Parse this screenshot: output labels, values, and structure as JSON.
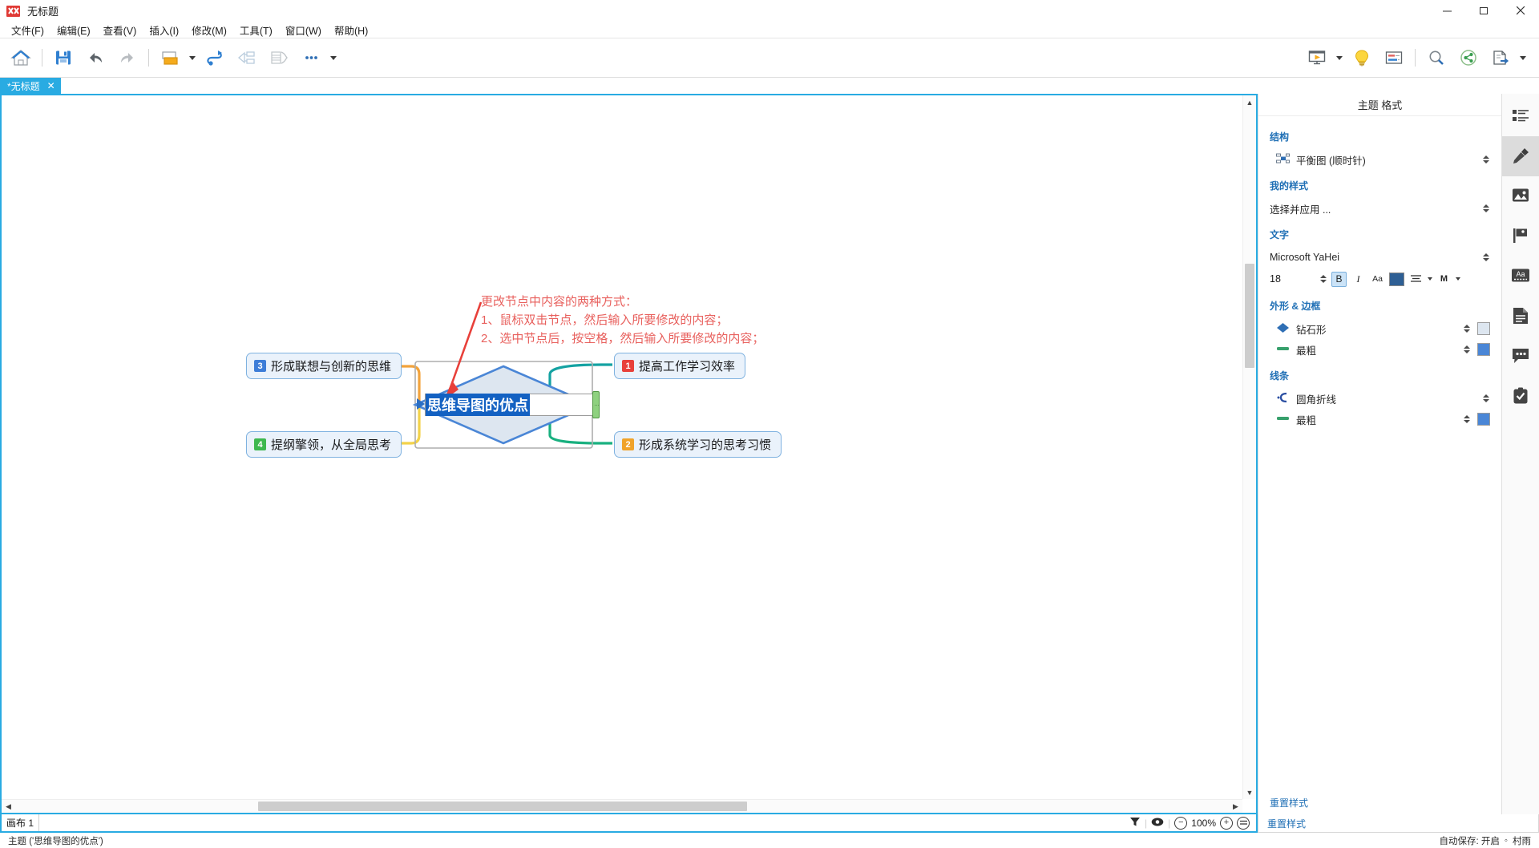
{
  "window": {
    "title": "无标题",
    "logo_icon": "xmind-logo-icon",
    "minimize": "–",
    "maximize": "❐",
    "close": "✕"
  },
  "menubar": {
    "items": [
      {
        "label": "文件(F)",
        "name": "menu-file"
      },
      {
        "label": "编辑(E)",
        "name": "menu-edit"
      },
      {
        "label": "查看(V)",
        "name": "menu-view"
      },
      {
        "label": "插入(I)",
        "name": "menu-insert"
      },
      {
        "label": "修改(M)",
        "name": "menu-modify"
      },
      {
        "label": "工具(T)",
        "name": "menu-tools"
      },
      {
        "label": "窗口(W)",
        "name": "menu-window"
      },
      {
        "label": "帮助(H)",
        "name": "menu-help"
      }
    ]
  },
  "toolbar": {
    "left": [
      {
        "icon": "home-icon",
        "name": "home-button"
      },
      {
        "icon": "save-icon",
        "name": "save-button"
      },
      {
        "icon": "undo-icon",
        "name": "undo-button"
      },
      {
        "icon": "redo-icon",
        "name": "redo-button"
      },
      {
        "icon": "topic-icon",
        "name": "insert-topic-button"
      },
      {
        "icon": "relationship-icon",
        "name": "relationship-button"
      },
      {
        "icon": "boundary-icon",
        "name": "boundary-button"
      },
      {
        "icon": "summary-icon",
        "name": "summary-button"
      },
      {
        "icon": "more-icon",
        "name": "more-button"
      }
    ],
    "right": [
      {
        "icon": "presentation-icon",
        "name": "presentation-button"
      },
      {
        "icon": "brainstorm-icon",
        "name": "brainstorm-button"
      },
      {
        "icon": "outline-icon",
        "name": "outline-button"
      },
      {
        "icon": "search-icon",
        "name": "search-button"
      },
      {
        "icon": "share-icon",
        "name": "share-button"
      },
      {
        "icon": "export-icon",
        "name": "export-button"
      }
    ]
  },
  "tabs": [
    {
      "label": "*无标题",
      "close": "✕",
      "active": true
    }
  ],
  "panel": {
    "title": "主题 格式",
    "structure": {
      "group": "结构",
      "value": "平衡图 (顺时针)",
      "icon": "structure-icon"
    },
    "mystyle": {
      "group": "我的样式",
      "value": "选择并应用 ..."
    },
    "text": {
      "group": "文字",
      "font_family": "Microsoft YaHei",
      "font_size": "18",
      "bold": "B",
      "italic": "I",
      "case": "Aa",
      "color": "#2e5f94",
      "align_icon": "align-icon",
      "margin": "M"
    },
    "shape": {
      "group": "外形 & 边框",
      "shape_name": "钻石形",
      "shape_icon": "diamond-icon",
      "shape_fill": "#dde6f0",
      "border_name": "最粗",
      "border_icon": "line-weight-icon",
      "border_color": "#4a86d6"
    },
    "lines": {
      "group": "线条",
      "line_name": "圆角折线",
      "line_icon": "elbow-line-icon",
      "weight_name": "最粗",
      "weight_icon": "line-weight-icon",
      "line_color": "#4a86d6"
    },
    "reset": "重置样式"
  },
  "rail": {
    "items": [
      {
        "icon": "properties-icon",
        "name": "rail-properties",
        "active": false
      },
      {
        "icon": "brush-icon",
        "name": "rail-style",
        "active": true
      },
      {
        "icon": "image-icon",
        "name": "rail-image",
        "active": false
      },
      {
        "icon": "marker-flag-icon",
        "name": "rail-marker",
        "active": false
      },
      {
        "icon": "text-aa-icon",
        "name": "rail-text",
        "active": false
      },
      {
        "icon": "notes-icon",
        "name": "rail-notes",
        "active": false
      },
      {
        "icon": "comment-icon",
        "name": "rail-comment",
        "active": false
      },
      {
        "icon": "task-clipboard-icon",
        "name": "rail-task",
        "active": false
      }
    ]
  },
  "mindmap": {
    "center": {
      "text": "思维导图的优点",
      "shape": "diamond",
      "fill": "#dde6f0",
      "stroke": "#4a86d6",
      "editing": true
    },
    "branches": [
      {
        "num": "1",
        "label": "提高工作学习效率",
        "badge_color": "#e8403a",
        "line_color": "#1aa5a5",
        "side": "right-top"
      },
      {
        "num": "2",
        "label": "形成系统学习的思考习惯",
        "badge_color": "#f0a32a",
        "line_color": "#19b07f",
        "side": "right-bottom"
      },
      {
        "num": "3",
        "label": "形成联想与创新的思维",
        "badge_color": "#3d7dd8",
        "line_color": "#f2a33c",
        "side": "left-top"
      },
      {
        "num": "4",
        "label": "提纲擎领，从全局思考",
        "badge_color": "#3db84f",
        "line_color": "#f2d24a",
        "side": "left-bottom"
      }
    ],
    "annotation": {
      "color": "#e8605d",
      "lines": [
        "更改节点中内容的两种方式：",
        "1、鼠标双击节点，然后输入所要修改的内容；",
        "2、选中节点后，按空格，然后输入所要修改的内容；"
      ]
    }
  },
  "sheet": {
    "tab_label": "画布 1",
    "filter_icon": "filter-icon",
    "eye_icon": "eye-icon",
    "zoom_out": "−",
    "zoom_level": "100%",
    "zoom_in": "+",
    "zoom_fit": "fit-icon"
  },
  "status": {
    "left": "主题 ('思维导图的优点')",
    "autosave": "自动保存: 开启",
    "user": "村雨",
    "user_dot": "◦"
  }
}
